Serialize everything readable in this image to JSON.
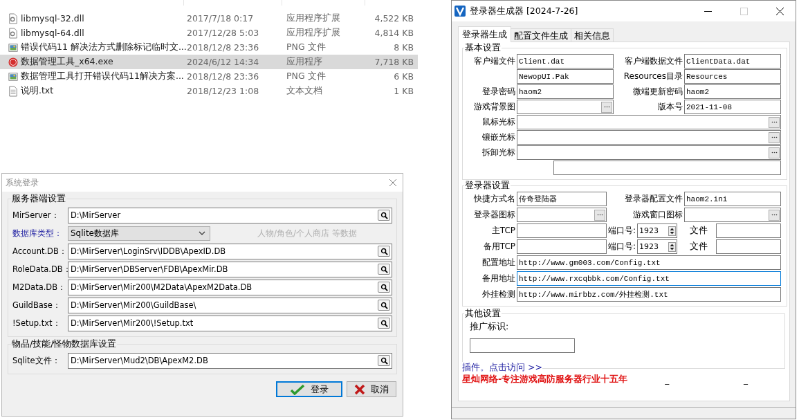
{
  "files": [
    {
      "kind": "dll",
      "name": "libmysql-32.dll",
      "date": "2017/7/18 0:17",
      "type": "应用程序扩展",
      "size": "4,522 KB",
      "selected": false
    },
    {
      "kind": "dll",
      "name": "libmysql-64.dll",
      "date": "2017/12/28 5:03",
      "type": "应用程序扩展",
      "size": "4,814 KB",
      "selected": false
    },
    {
      "kind": "png",
      "name": "错误代码11 解决法方式删除标记临时文...",
      "date": "2018/12/8 23:36",
      "type": "PNG 文件",
      "size": "8 KB",
      "selected": false
    },
    {
      "kind": "exe",
      "name": "数据管理工具_x64.exe",
      "date": "2024/6/12 14:34",
      "type": "应用程序",
      "size": "7,718 KB",
      "selected": true
    },
    {
      "kind": "png",
      "name": "数据管理工具打开错误代码11解决方案...",
      "date": "2018/12/8 23:36",
      "type": "PNG 文件",
      "size": "6 KB",
      "selected": false
    },
    {
      "kind": "txt",
      "name": "说明.txt",
      "date": "2018/12/23 1:08",
      "type": "文本文档",
      "size": "1 KB",
      "selected": false
    }
  ],
  "login": {
    "title": "系统登录",
    "groups": [
      {
        "title": "服务器端设置",
        "rows": [
          {
            "kind": "path",
            "label": "MirServer：",
            "value": "D:\\MirServer"
          },
          {
            "kind": "select",
            "label": "数据库类型：",
            "value": "Sqlite数据库",
            "hint": "人物/角色/个人商店 等数据"
          },
          {
            "kind": "path",
            "label": "Account.DB：",
            "value": "D:\\MirServer\\LoginSrv\\IDDB\\ApexID.DB"
          },
          {
            "kind": "path",
            "label": "RoleData.DB：",
            "value": "D:\\MirServer\\DBServer\\FDB\\ApexMir.DB"
          },
          {
            "kind": "path",
            "label": "M2Data.DB：",
            "value": "D:\\MirServer\\Mir200\\M2Data\\ApexM2Data.DB"
          },
          {
            "kind": "path",
            "label": "GuildBase：",
            "value": "D:\\MirServer\\Mir200\\GuildBase\\"
          },
          {
            "kind": "path",
            "label": "!Setup.txt：",
            "value": "D:\\MirServer\\Mir200\\!Setup.txt"
          }
        ]
      },
      {
        "title": "物品/技能/怪物数据库设置",
        "rows": [
          {
            "kind": "path",
            "label": "Sqlite文件：",
            "value": "D:\\MirServer\\Mud2\\DB\\ApexM2.DB"
          }
        ]
      }
    ],
    "buttons": [
      {
        "kind": "ok",
        "label": "登录",
        "default": true
      },
      {
        "kind": "cancel",
        "label": "取消",
        "default": false
      }
    ]
  },
  "generator": {
    "title": "登录器生成器 [2024-7-26]",
    "tabs": [
      {
        "label": "登录器生成",
        "selected": true
      },
      {
        "label": "配置文件生成",
        "selected": false
      },
      {
        "label": "相关信息",
        "selected": false
      }
    ],
    "basic": {
      "title": "基本设置",
      "rows": [
        {
          "kind": "pair",
          "left": {
            "label": "客户端文件",
            "value": "Client.dat"
          },
          "right": {
            "label": "客户端数据文件",
            "value": "ClientData.dat"
          }
        },
        {
          "kind": "pair",
          "left": {
            "value": "NewopUI.Pak"
          },
          "right": {
            "label": "Resources目录",
            "value": "Resources"
          }
        },
        {
          "kind": "pair",
          "left": {
            "label": "登录密码",
            "value": "haom2"
          },
          "right": {
            "label": "微端更新密码",
            "value": "haom2"
          }
        },
        {
          "kind": "pair",
          "left": {
            "label": "游戏背景图",
            "browse": true
          },
          "right": {
            "label": "版本号",
            "value": "2021-11-08"
          }
        },
        {
          "kind": "wide",
          "label": "鼠标光标",
          "browse": true,
          "focused": false
        },
        {
          "kind": "wide",
          "label": "镶嵌光标",
          "browse": true,
          "focused": false
        },
        {
          "kind": "wide",
          "label": "拆卸光标",
          "browse": true,
          "focused": false
        },
        {
          "kind": "blank"
        }
      ]
    },
    "launcher": {
      "title": "登录器设置",
      "rows": [
        {
          "kind": "pair",
          "left": {
            "label": "快捷方式名",
            "value": "传奇登陆器"
          },
          "right": {
            "label": "登录器配置文件",
            "value": "haom2.ini"
          }
        },
        {
          "kind": "pair",
          "left": {
            "label": "登录器图标",
            "browse": true
          },
          "right": {
            "label": "游戏窗口图标",
            "browse": true
          }
        },
        {
          "kind": "tcp",
          "label": "主TCP",
          "port_label": "端口号:",
          "port": "1923",
          "file_label": "文件"
        },
        {
          "kind": "tcp",
          "label": "备用TCP",
          "port_label": "端口号:",
          "port": "1923",
          "file_label": "文件"
        },
        {
          "kind": "wide",
          "label": "配置地址",
          "value": "http://www.gm003.com/Config.txt",
          "focused": false
        },
        {
          "kind": "wide",
          "label": "备用地址",
          "value": "http://www.rxcqbbk.com/Config.txt",
          "focused": true
        },
        {
          "kind": "wide",
          "label": "外挂检测",
          "value": "http://www.mirbbz.com/外挂检测.txt",
          "focused": false
        }
      ]
    },
    "other": {
      "title": "其他设置",
      "label": "推广标识:"
    },
    "link": "插件。点击访问 >>",
    "slogan": "星灿网络-专注游戏高防服务器行业十五年",
    "marks": [
      "_",
      "_"
    ]
  }
}
